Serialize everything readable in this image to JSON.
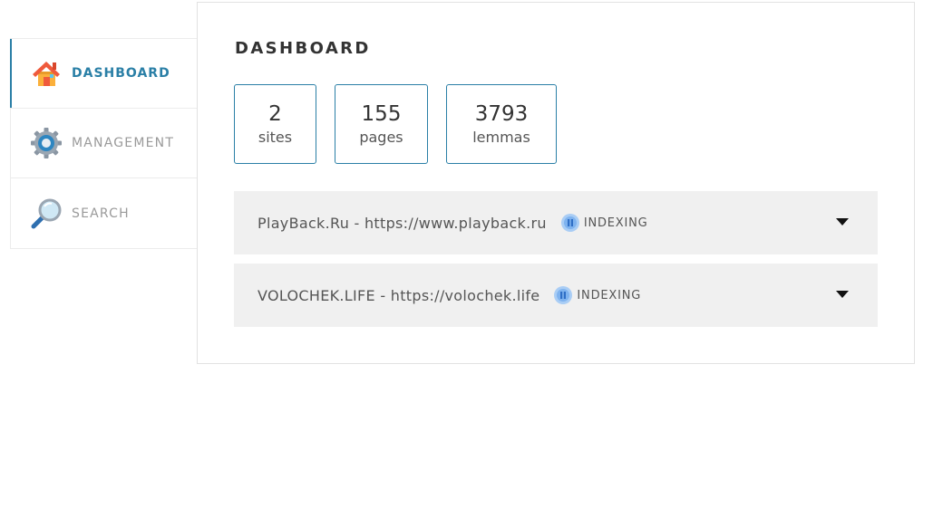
{
  "sidebar": {
    "items": [
      {
        "label": "DASHBOARD",
        "icon": "home-icon",
        "active": true
      },
      {
        "label": "MANAGEMENT",
        "icon": "gear-icon",
        "active": false
      },
      {
        "label": "SEARCH",
        "icon": "magnifier-icon",
        "active": false
      }
    ]
  },
  "main": {
    "title": "DASHBOARD",
    "stats": [
      {
        "value": "2",
        "label": "sites"
      },
      {
        "value": "155",
        "label": "pages"
      },
      {
        "value": "3793",
        "label": "lemmas"
      }
    ],
    "sites": [
      {
        "name": "PlayBack.Ru - https://www.playback.ru",
        "status": "INDEXING",
        "status_icon": "pause-icon"
      },
      {
        "name": "VOLOCHEK.LIFE - https://volochek.life",
        "status": "INDEXING",
        "status_icon": "pause-icon"
      }
    ]
  },
  "colors": {
    "accent": "#2a7fa6",
    "inactive_text": "#9a9a9a",
    "row_background": "#f0f0f0",
    "status_icon": "#4a90e2"
  }
}
